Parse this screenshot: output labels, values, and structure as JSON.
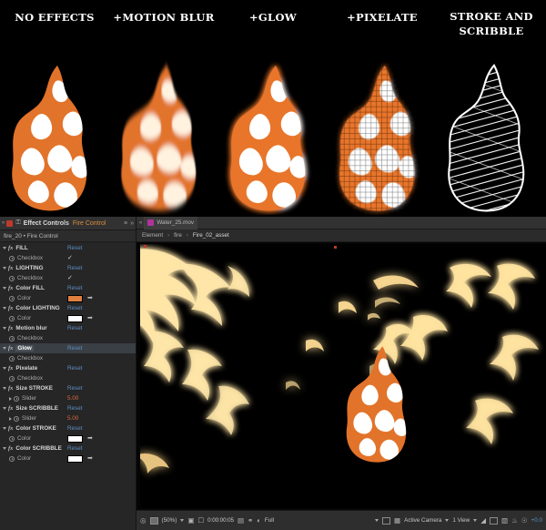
{
  "showcase": {
    "columns": [
      {
        "label": "NO EFFECTS",
        "variant": "plain"
      },
      {
        "label": "+MOTION BLUR",
        "variant": "blur"
      },
      {
        "label": "+GLOW",
        "variant": "glow"
      },
      {
        "label": "+PIXELATE",
        "variant": "pixelate"
      },
      {
        "label": "STROKE AND SCRIBBLE",
        "variant": "scribble"
      }
    ],
    "flame_fill_color": "#E2732A",
    "flame_inner_color": "#FFFFFF",
    "background_color": "#000000"
  },
  "effect_controls": {
    "tab_title": "Effect Controls",
    "tab_comp": "Fire Control",
    "menu_glyph": "≡",
    "close_glyph": "»",
    "arrow_glyph": "«",
    "lock_glyph": "⚿",
    "breadcrumb": "fire_20 • Fire Control",
    "reset_label": "Reset",
    "eyedropper_glyph": "➡",
    "check_glyph": "✓",
    "rows": [
      {
        "kind": "effect",
        "name": "FILL",
        "action": "Reset",
        "selected": false
      },
      {
        "kind": "param",
        "name": "Checkbox",
        "control": "check"
      },
      {
        "kind": "effect",
        "name": "LIGHTING",
        "action": "Reset",
        "selected": false
      },
      {
        "kind": "param",
        "name": "Checkbox",
        "control": "check"
      },
      {
        "kind": "effect",
        "name": "Color FILL",
        "action": "Reset",
        "selected": false
      },
      {
        "kind": "param",
        "name": "Color",
        "control": "swatch",
        "color": "#E08040"
      },
      {
        "kind": "effect",
        "name": "Color LIGHTING",
        "action": "Reset",
        "selected": false
      },
      {
        "kind": "param",
        "name": "Color",
        "control": "swatch",
        "color": "#FFFFFF"
      },
      {
        "kind": "effect",
        "name": "Motion blur",
        "action": "Reset",
        "selected": false
      },
      {
        "kind": "param",
        "name": "Checkbox",
        "control": "check-off"
      },
      {
        "kind": "effect",
        "name": "Glow",
        "action": "Reset",
        "selected": true
      },
      {
        "kind": "param",
        "name": "Checkbox",
        "control": "check-off"
      },
      {
        "kind": "effect",
        "name": "Pixelate",
        "action": "Reset",
        "selected": false
      },
      {
        "kind": "param",
        "name": "Checkbox",
        "control": "check-off"
      },
      {
        "kind": "effect",
        "name": "Size STROKE",
        "action": "Reset",
        "selected": false
      },
      {
        "kind": "param",
        "name": "Slider",
        "control": "value",
        "value": "5.00",
        "expandable": true
      },
      {
        "kind": "effect",
        "name": "Size SCRIBBLE",
        "action": "Reset",
        "selected": false
      },
      {
        "kind": "param",
        "name": "Slider",
        "control": "value",
        "value": "5.00",
        "expandable": true
      },
      {
        "kind": "effect",
        "name": "Color STROKE",
        "action": "Reset",
        "selected": false
      },
      {
        "kind": "param",
        "name": "Color",
        "control": "swatch",
        "color": "#FFFFFF"
      },
      {
        "kind": "effect",
        "name": "Color SCRIBBLE",
        "action": "Reset",
        "selected": false
      },
      {
        "kind": "param",
        "name": "Color",
        "control": "swatch",
        "color": "#FFFFFF"
      }
    ]
  },
  "viewer": {
    "tab_label": "Water_25.mov",
    "breadcrumb": {
      "root": "Element",
      "mid": "fire",
      "current": "Fire_02_asset",
      "separator": "›"
    },
    "toolbar": {
      "zoom": "(50%)",
      "timecode": "0:00:00:05",
      "resolution": "Full",
      "camera": "Active Camera",
      "views": "1 View",
      "exposure": "+0.0",
      "caret_glyph": "▾"
    }
  }
}
